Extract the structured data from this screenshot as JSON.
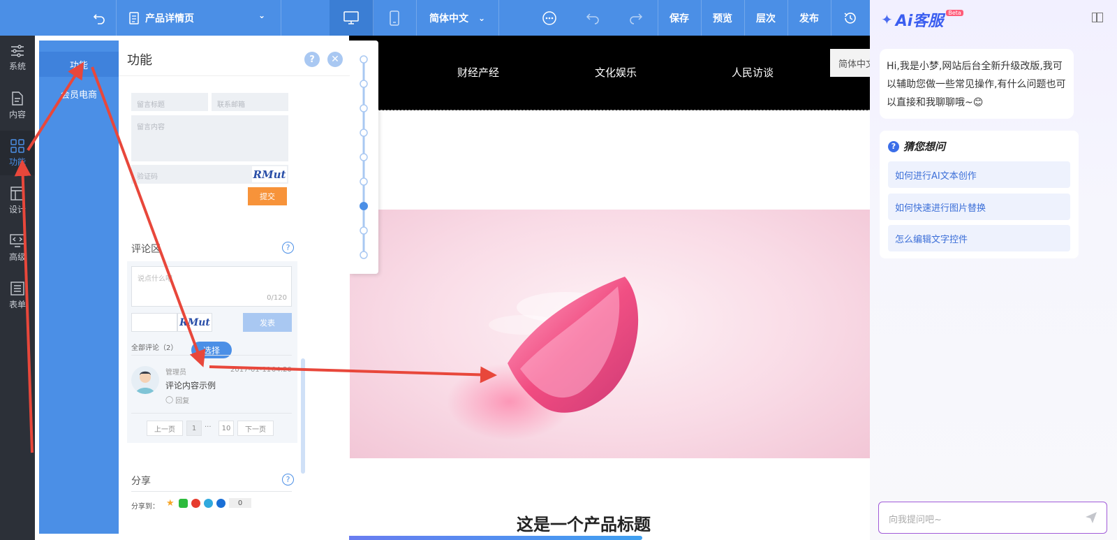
{
  "toolbar": {
    "page_name": "产品详情页",
    "language": "简体中文",
    "save": "保存",
    "preview": "预览",
    "layers": "层次",
    "publish": "发布"
  },
  "rail": {
    "items": [
      {
        "label": "系统",
        "icon": "sliders-icon"
      },
      {
        "label": "内容",
        "icon": "document-icon"
      },
      {
        "label": "功能",
        "icon": "grid-icon"
      },
      {
        "label": "设计",
        "icon": "layout-icon"
      },
      {
        "label": "高级",
        "icon": "code-monitor-icon"
      },
      {
        "label": "表单",
        "icon": "form-list-icon"
      }
    ]
  },
  "blue_panel": {
    "items": [
      {
        "label": "功能"
      },
      {
        "label": "会员电商"
      }
    ]
  },
  "panel": {
    "title": "功能",
    "form": {
      "title_placeholder": "留言标题",
      "email_placeholder": "联系邮箱",
      "content_placeholder": "留言内容",
      "captcha_placeholder": "验证码",
      "captcha_text": "RMut",
      "submit": "提交"
    },
    "comments": {
      "section_title": "评论区",
      "textarea_placeholder": "说点什么吧",
      "counter": "0/120",
      "captcha_text": "RMut",
      "post_button": "发表",
      "all_comments": "全部评论（2）",
      "select_badge": "选择",
      "item": {
        "author": "管理员",
        "date": "2017-01-11",
        "time": "04:20",
        "text": "评论内容示例",
        "reply": "回复"
      },
      "pagination": {
        "prev": "上一页",
        "page1": "1",
        "ellipsis": "···",
        "last": "10",
        "next": "下一页"
      }
    },
    "share": {
      "section_title": "分享",
      "label": "分享到：",
      "count": "0",
      "icons": [
        "qzone-icon",
        "wechat-icon",
        "weibo-icon",
        "tencent-weibo-icon",
        "renren-icon"
      ]
    }
  },
  "canvas": {
    "nav": [
      "财经产经",
      "文化娱乐",
      "人民访谈"
    ],
    "language_select": "简体中文",
    "product_title": "这是一个产品标题"
  },
  "ai": {
    "title": "Ai客服",
    "beta": "Beta",
    "greeting": "Hi,我是小梦,网站后台全新升级改版,我可以辅助您做一些常见操作,有什么问题也可以直接和我聊聊哦~😊",
    "suggest_title": "猜您想问",
    "questions": [
      "如何进行AI文本创作",
      "如何快速进行图片替换",
      "怎么编辑文字控件"
    ],
    "input_placeholder": "向我提问吧~"
  },
  "colors": {
    "primary": "#4b8fe6",
    "rail_bg": "#2c3038",
    "submit_orange": "#f7933a",
    "arrow_red": "#e8473b"
  }
}
